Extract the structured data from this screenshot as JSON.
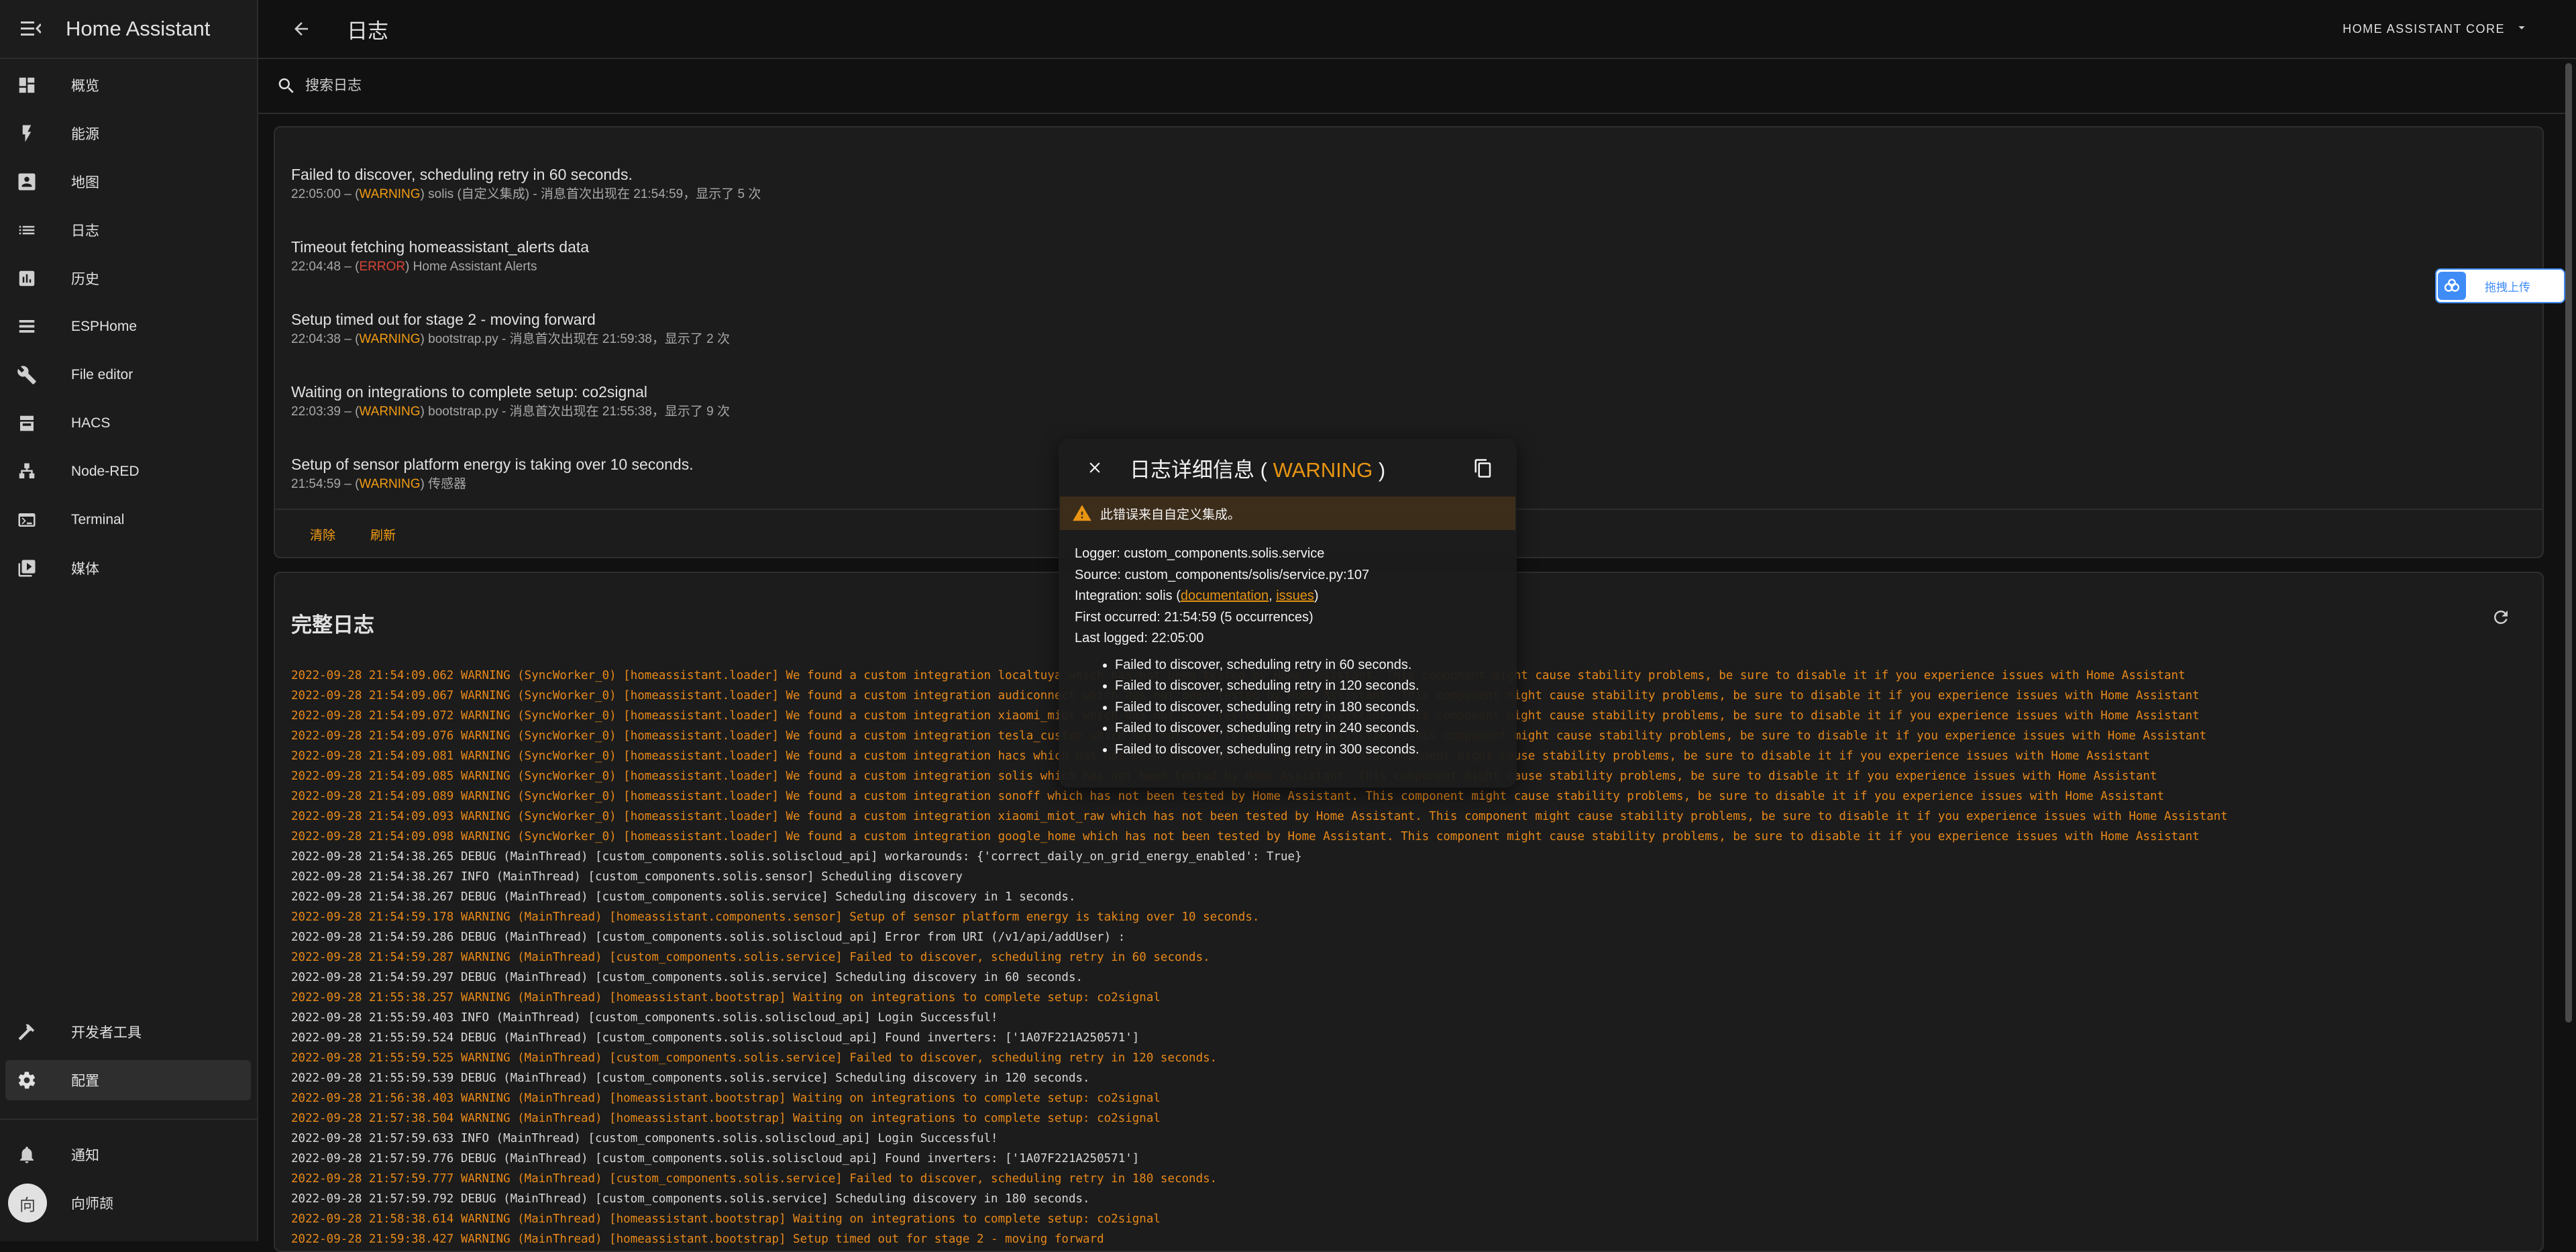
{
  "sidebar": {
    "title": "Home Assistant",
    "items": [
      {
        "label": "概览",
        "icon": "dashboard-icon"
      },
      {
        "label": "能源",
        "icon": "lightning-icon"
      },
      {
        "label": "地图",
        "icon": "map-icon"
      },
      {
        "label": "日志",
        "icon": "list-icon"
      },
      {
        "label": "历史",
        "icon": "chart-icon"
      },
      {
        "label": "ESPHome",
        "icon": "esphome-icon"
      },
      {
        "label": "File editor",
        "icon": "wrench-icon"
      },
      {
        "label": "HACS",
        "icon": "hacs-icon"
      },
      {
        "label": "Node-RED",
        "icon": "sitemap-icon"
      },
      {
        "label": "Terminal",
        "icon": "console-icon"
      },
      {
        "label": "媒体",
        "icon": "play-box-icon"
      }
    ],
    "bottom_items": [
      {
        "label": "开发者工具",
        "icon": "hammer-icon"
      },
      {
        "label": "配置",
        "icon": "gear-icon"
      }
    ],
    "notifications_label": "通知",
    "user": {
      "initial": "向",
      "name": "向师颉"
    }
  },
  "header": {
    "title": "日志",
    "core_select": "HOME ASSISTANT CORE"
  },
  "search": {
    "placeholder": "搜索日志"
  },
  "system_log": {
    "entries": [
      {
        "message": "Failed to discover, scheduling retry in 60 seconds.",
        "time": "22:05:00",
        "level": "WARNING",
        "detail": " solis (自定义集成) - 消息首次出现在 21:54:59，显示了 5 次"
      },
      {
        "message": "Timeout fetching homeassistant_alerts data",
        "time": "22:04:48",
        "level": "ERROR",
        "detail": " Home Assistant Alerts"
      },
      {
        "message": "Setup timed out for stage 2 - moving forward",
        "time": "22:04:38",
        "level": "WARNING",
        "detail": " bootstrap.py - 消息首次出现在 21:59:38，显示了 2 次"
      },
      {
        "message": "Waiting on integrations to complete setup: co2signal",
        "time": "22:03:39",
        "level": "WARNING",
        "detail": " bootstrap.py - 消息首次出现在 21:55:38，显示了 9 次"
      },
      {
        "message": "Setup of sensor platform energy is taking over 10 seconds.",
        "time": "21:54:59",
        "level": "WARNING",
        "detail": " 传感器"
      }
    ],
    "clear_label": "清除",
    "refresh_label": "刷新"
  },
  "full_log": {
    "title": "完整日志",
    "lines": [
      {
        "text": "2022-09-28 21:54:09.062 WARNING (SyncWorker_0) [homeassistant.loader] We found a custom integration localtuya which has not been tested by Home Assistant. This component might cause stability problems, be sure to disable it if you experience issues with Home Assistant",
        "level": "warning"
      },
      {
        "text": "2022-09-28 21:54:09.067 WARNING (SyncWorker_0) [homeassistant.loader] We found a custom integration audiconnect which has not been tested by Home Assistant. This component might cause stability problems, be sure to disable it if you experience issues with Home Assistant",
        "level": "warning"
      },
      {
        "text": "2022-09-28 21:54:09.072 WARNING (SyncWorker_0) [homeassistant.loader] We found a custom integration xiaomi_miot which has not been tested by Home Assistant. This component might cause stability problems, be sure to disable it if you experience issues with Home Assistant",
        "level": "warning"
      },
      {
        "text": "2022-09-28 21:54:09.076 WARNING (SyncWorker_0) [homeassistant.loader] We found a custom integration tesla_custom which has not been tested by Home Assistant. This component might cause stability problems, be sure to disable it if you experience issues with Home Assistant",
        "level": "warning"
      },
      {
        "text": "2022-09-28 21:54:09.081 WARNING (SyncWorker_0) [homeassistant.loader] We found a custom integration hacs which has not been tested by Home Assistant. This component might cause stability problems, be sure to disable it if you experience issues with Home Assistant",
        "level": "warning"
      },
      {
        "text": "2022-09-28 21:54:09.085 WARNING (SyncWorker_0) [homeassistant.loader] We found a custom integration solis which has not been tested by Home Assistant. This component might cause stability problems, be sure to disable it if you experience issues with Home Assistant",
        "level": "warning"
      },
      {
        "text": "2022-09-28 21:54:09.089 WARNING (SyncWorker_0) [homeassistant.loader] We found a custom integration sonoff which has not been tested by Home Assistant. This component might cause stability problems, be sure to disable it if you experience issues with Home Assistant",
        "level": "warning"
      },
      {
        "text": "2022-09-28 21:54:09.093 WARNING (SyncWorker_0) [homeassistant.loader] We found a custom integration xiaomi_miot_raw which has not been tested by Home Assistant. This component might cause stability problems, be sure to disable it if you experience issues with Home Assistant",
        "level": "warning"
      },
      {
        "text": "2022-09-28 21:54:09.098 WARNING (SyncWorker_0) [homeassistant.loader] We found a custom integration google_home which has not been tested by Home Assistant. This component might cause stability problems, be sure to disable it if you experience issues with Home Assistant",
        "level": "warning"
      },
      {
        "text": "2022-09-28 21:54:38.265 DEBUG (MainThread) [custom_components.solis.soliscloud_api] workarounds: {'correct_daily_on_grid_energy_enabled': True}",
        "level": "info"
      },
      {
        "text": "2022-09-28 21:54:38.267 INFO (MainThread) [custom_components.solis.sensor] Scheduling discovery",
        "level": "info"
      },
      {
        "text": "2022-09-28 21:54:38.267 DEBUG (MainThread) [custom_components.solis.service] Scheduling discovery in 1 seconds.",
        "level": "info"
      },
      {
        "text": "2022-09-28 21:54:59.178 WARNING (MainThread) [homeassistant.components.sensor] Setup of sensor platform energy is taking over 10 seconds.",
        "level": "warning"
      },
      {
        "text": "2022-09-28 21:54:59.286 DEBUG (MainThread) [custom_components.solis.soliscloud_api] Error from URI (/v1/api/addUser) :",
        "level": "info"
      },
      {
        "text": "2022-09-28 21:54:59.287 WARNING (MainThread) [custom_components.solis.service] Failed to discover, scheduling retry in 60 seconds.",
        "level": "warning"
      },
      {
        "text": "2022-09-28 21:54:59.297 DEBUG (MainThread) [custom_components.solis.service] Scheduling discovery in 60 seconds.",
        "level": "info"
      },
      {
        "text": "2022-09-28 21:55:38.257 WARNING (MainThread) [homeassistant.bootstrap] Waiting on integrations to complete setup: co2signal",
        "level": "warning"
      },
      {
        "text": "2022-09-28 21:55:59.403 INFO (MainThread) [custom_components.solis.soliscloud_api] Login Successful!",
        "level": "info"
      },
      {
        "text": "2022-09-28 21:55:59.524 DEBUG (MainThread) [custom_components.solis.soliscloud_api] Found inverters: ['1A07F221A250571']",
        "level": "info"
      },
      {
        "text": "2022-09-28 21:55:59.525 WARNING (MainThread) [custom_components.solis.service] Failed to discover, scheduling retry in 120 seconds.",
        "level": "warning"
      },
      {
        "text": "2022-09-28 21:55:59.539 DEBUG (MainThread) [custom_components.solis.service] Scheduling discovery in 120 seconds.",
        "level": "info"
      },
      {
        "text": "2022-09-28 21:56:38.403 WARNING (MainThread) [homeassistant.bootstrap] Waiting on integrations to complete setup: co2signal",
        "level": "warning"
      },
      {
        "text": "2022-09-28 21:57:38.504 WARNING (MainThread) [homeassistant.bootstrap] Waiting on integrations to complete setup: co2signal",
        "level": "warning"
      },
      {
        "text": "2022-09-28 21:57:59.633 INFO (MainThread) [custom_components.solis.soliscloud_api] Login Successful!",
        "level": "info"
      },
      {
        "text": "2022-09-28 21:57:59.776 DEBUG (MainThread) [custom_components.solis.soliscloud_api] Found inverters: ['1A07F221A250571']",
        "level": "info"
      },
      {
        "text": "2022-09-28 21:57:59.777 WARNING (MainThread) [custom_components.solis.service] Failed to discover, scheduling retry in 180 seconds.",
        "level": "warning"
      },
      {
        "text": "2022-09-28 21:57:59.792 DEBUG (MainThread) [custom_components.solis.service] Scheduling discovery in 180 seconds.",
        "level": "info"
      },
      {
        "text": "2022-09-28 21:58:38.614 WARNING (MainThread) [homeassistant.bootstrap] Waiting on integrations to complete setup: co2signal",
        "level": "warning"
      },
      {
        "text": "2022-09-28 21:59:38.427 WARNING (MainThread) [homeassistant.bootstrap] Setup timed out for stage 2 - moving forward",
        "level": "warning"
      }
    ]
  },
  "dialog": {
    "title": "日志详细信息",
    "level": "WARNING",
    "paren_open": " ( ",
    "paren_close": " )",
    "alert_text": "此错误来自自定义集成。",
    "logger": "Logger: custom_components.solis.service",
    "source": "Source: custom_components/solis/service.py:107",
    "integration_prefix": "Integration: solis (",
    "documentation_link": "documentation",
    "comma": ", ",
    "issues_link": "issues",
    "integration_suffix": ")",
    "first_occurred": "First occurred: 21:54:59 (5 occurrences)",
    "last_logged": "Last logged: 22:05:00",
    "messages": [
      "Failed to discover, scheduling retry in 60 seconds.",
      "Failed to discover, scheduling retry in 120 seconds.",
      "Failed to discover, scheduling retry in 180 seconds.",
      "Failed to discover, scheduling retry in 240 seconds.",
      "Failed to discover, scheduling retry in 300 seconds."
    ]
  },
  "upload_widget": {
    "label": "拖拽上传"
  },
  "colors": {
    "warning": "#f39c12",
    "error": "#db4437",
    "background": "#111111",
    "card": "#1c1c1c"
  }
}
